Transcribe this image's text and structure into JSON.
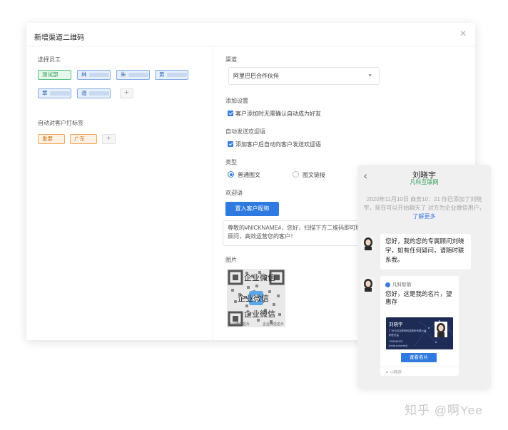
{
  "dialog": {
    "title": "新增渠道二维码",
    "close_icon": "close-icon"
  },
  "left": {
    "employee_label": "选择员工",
    "employees": [
      {
        "text": "测试部",
        "color": "green",
        "blurred": false
      },
      {
        "text": "林",
        "color": "blue",
        "blurred": true
      },
      {
        "text": "朱",
        "color": "blue",
        "blurred": true
      },
      {
        "text": "黄",
        "color": "blue",
        "blurred": true
      },
      {
        "text": "覃",
        "color": "blue",
        "blurred": true
      },
      {
        "text": "温",
        "color": "blue",
        "blurred": true
      }
    ],
    "tag_label": "自动对客户打标签",
    "tags": [
      {
        "text": "重要",
        "color": "orange"
      },
      {
        "text": "广东",
        "color": "orange"
      }
    ],
    "add_symbol": "+"
  },
  "right": {
    "channel_label": "渠道",
    "channel_value": "阿里巴巴合作伙伴",
    "add_settings_label": "添加设置",
    "add_settings_option": "客户添加时无需确认自动成为好友",
    "auto_welcome_label": "自动发送欢迎语",
    "auto_welcome_option": "添加客户后自动向客户发送欢迎语",
    "type_label": "类型",
    "type_options": [
      "普通图文",
      "图文链接"
    ],
    "type_selected": 0,
    "welcome_label": "欢迎语",
    "insert_button": "置入客户昵称",
    "welcome_text": "尊敬的#NICKNAME#，您好，扫描下方二维码即可联系专属顾问，高效运营您的客户！",
    "image_label": "图片",
    "qr_texts": [
      "企业微信",
      "企业微信",
      "企业微信"
    ],
    "qr_small": [
      "企业微信名片",
      "企业微信名片"
    ]
  },
  "phone": {
    "back_icon": "‹",
    "name": "刘晓宇",
    "org": "凡科互联网",
    "system_msg": "2020年11月10日 商务10：21 你已添加了刘晓宇，现在可以开始聊天了 对方为企业微信用户，",
    "system_link": "了解更多",
    "msg1": "您好，我的您的专属顾问刘晓宇，如有任何疑问，请随时联系我。",
    "card_sender": "凡科智销",
    "card_title": "您好，这是我的名片，望惠存",
    "card_person": "刘晓宇",
    "card_company": "广州凡科互联网科技股份有限公司",
    "card_role": "销售总监",
    "card_phone": "1355464333",
    "card_email": "[email protected]",
    "card_button": "查看名片",
    "card_footer": "小程序"
  },
  "watermark": "知乎 @啊Yee"
}
